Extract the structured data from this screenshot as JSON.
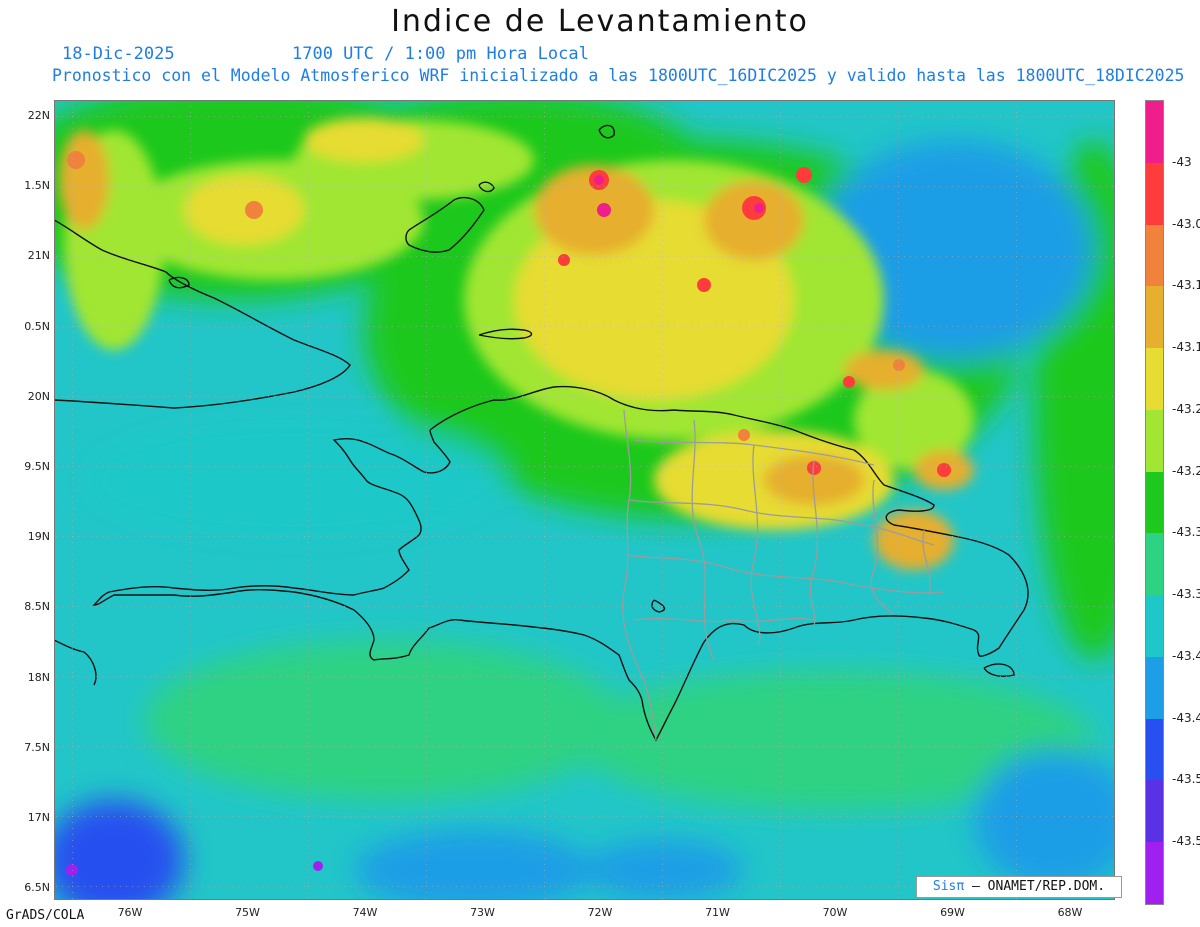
{
  "title": "Indice de Levantamiento",
  "date": "18-Dic-2025",
  "time": "1700 UTC / 1:00 pm Hora Local",
  "description": "Pronostico con el Modelo Atmosferico WRF inicializado a las 1800UTC_16DIC2025 y valido hasta las  1800UTC_18DIC2025",
  "lat_labels": [
    "22N",
    "1.5N",
    "21N",
    "0.5N",
    "20N",
    "9.5N",
    "19N",
    "8.5N",
    "18N",
    "7.5N",
    "17N",
    "6.5N"
  ],
  "lon_labels": [
    "76W",
    "75W",
    "74W",
    "73W",
    "72W",
    "71W",
    "70W",
    "69W",
    "68W"
  ],
  "software_label": "GrADS/COLA",
  "credit": {
    "brand": "Sisπ",
    "org": "– ONAMET/REP.DOM."
  },
  "colorbar": {
    "labels": [
      "-43",
      "-43.0",
      "-43.1",
      "-43.1",
      "-43.2",
      "-43.2",
      "-43.3",
      "-43.3",
      "-43.4",
      "-43.4",
      "-43.5",
      "-43.5"
    ],
    "colors": [
      "#f01e8c",
      "#ff3c3c",
      "#f0823c",
      "#e6af2d",
      "#e6dc32",
      "#a0e632",
      "#1ec81e",
      "#2dd282",
      "#1ec8c8",
      "#1e9ee6",
      "#2850f0",
      "#5a32e6",
      "#a020f0"
    ]
  }
}
